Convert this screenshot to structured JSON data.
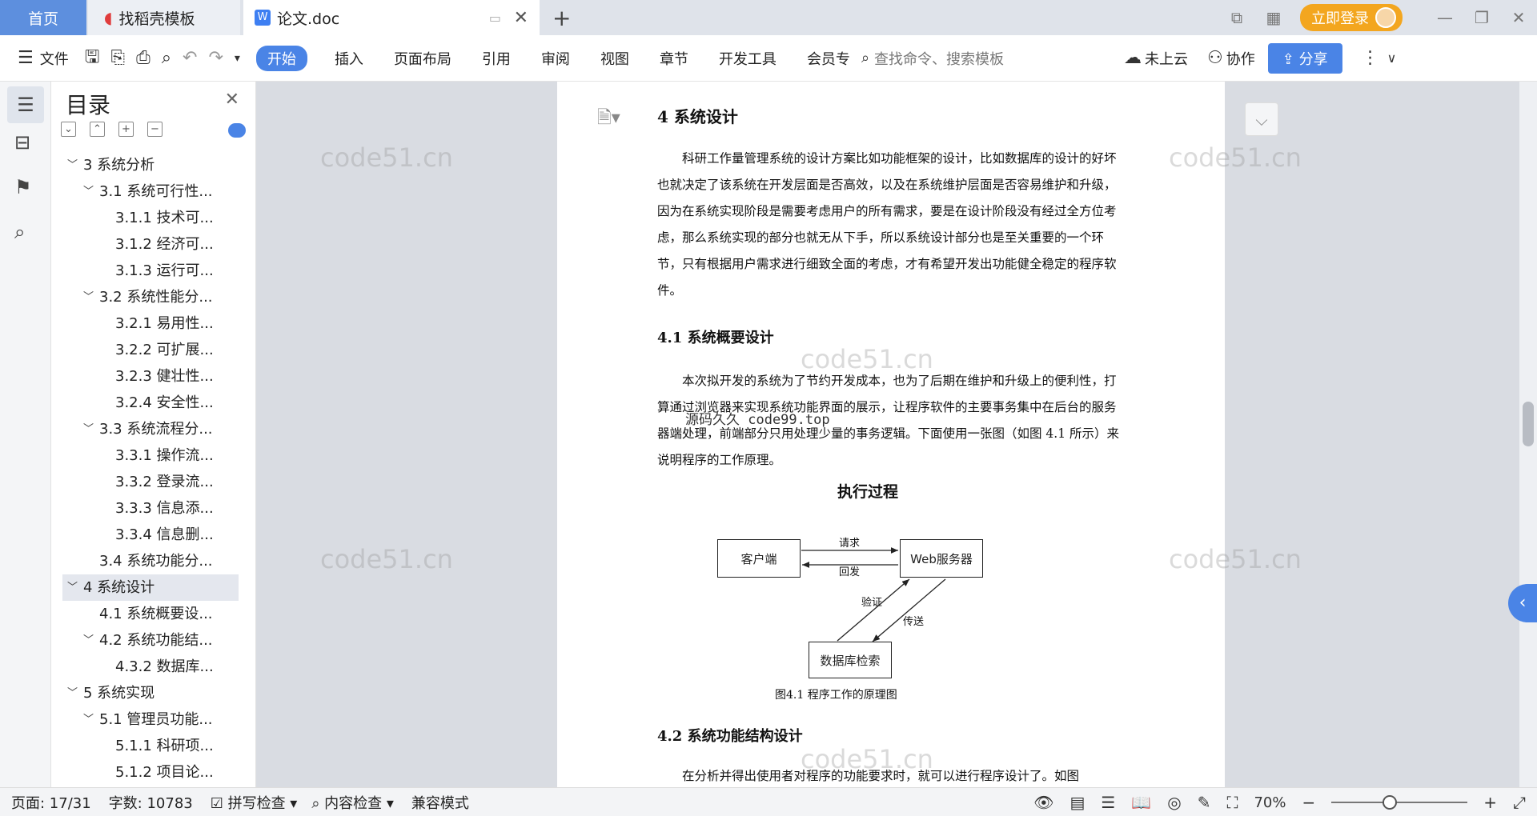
{
  "tabs": {
    "home": "首页",
    "daoke": "找稻壳模板",
    "doc": "论文.doc"
  },
  "login": "立即登录",
  "menu": {
    "file": "文件",
    "start": "开始",
    "insert": "插入",
    "layout": "页面布局",
    "reference": "引用",
    "review": "审阅",
    "view": "视图",
    "chapter": "章节",
    "devtools": "开发工具",
    "member": "会员专",
    "search_placeholder": "查找命令、搜索模板",
    "cloud": "未上云",
    "collab": "协作",
    "share": "分享"
  },
  "toc": {
    "title": "目录",
    "items": [
      "3  系统分析",
      "3.1  系统可行性...",
      "3.1.1  技术可...",
      "3.1.2  经济可...",
      "3.1.3  运行可...",
      "3.2  系统性能分...",
      "3.2.1  易用性...",
      "3.2.2  可扩展...",
      "3.2.3  健壮性...",
      "3.2.4  安全性...",
      "3.3  系统流程分...",
      "3.3.1  操作流...",
      "3.3.2  登录流...",
      "3.3.3  信息添...",
      "3.3.4  信息删...",
      "3.4  系统功能分...",
      "4  系统设计",
      "4.1  系统概要设...",
      "4.2  系统功能结...",
      "4.3.2  数据库...",
      "5  系统实现",
      "5.1  管理员功能...",
      "5.1.1  科研项...",
      "5.1.2  项目论..."
    ]
  },
  "doc": {
    "h1": "4  系统设计",
    "p1": "科研工作量管理系统的设计方案比如功能框架的设计，比如数据库的设计的好坏也就决定了该系统在开发层面是否高效，以及在系统维护层面是否容易维护和升级，因为在系统实现阶段是需要考虑用户的所有需求，要是在设计阶段没有经过全方位考虑，那么系统实现的部分也就无从下手，所以系统设计部分也是至关重要的一个环节，只有根据用户需求进行细致全面的考虑，才有希望开发出功能健全稳定的程序软件。",
    "h2a": "4.1  系统概要设计",
    "p2": "本次拟开发的系统为了节约开发成本，也为了后期在维护和升级上的便利性，打算通过浏览器来实现系统功能界面的展示，让程序软件的主要事务集中在后台的服务器端处理，前端部分只用处理少量的事务逻辑。下面使用一张图（如图 4.1 所示）来说明程序的工作原理。",
    "diagram": {
      "title": "执行过程",
      "client": "客户端",
      "server": "Web服务器",
      "db": "数据库检索",
      "req": "请求",
      "resp": "回发",
      "verify": "验证",
      "send": "传送",
      "caption": "图4.1  程序工作的原理图"
    },
    "h2b": "4.2  系统功能结构设计",
    "p3": "在分析并得出使用者对程序的功能要求时，就可以进行程序设计了。如图",
    "overlay": "源码久久 code99.top"
  },
  "watermark": "code51.cn",
  "status": {
    "page": "页面: 17/31",
    "words": "字数: 10783",
    "spell": "拼写检查",
    "content": "内容检查",
    "compat": "兼容模式",
    "zoom": "70%"
  }
}
